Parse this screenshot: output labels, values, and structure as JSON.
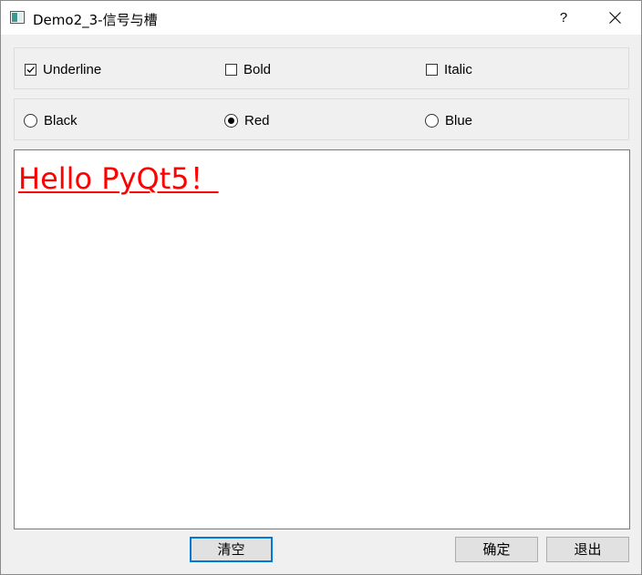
{
  "window": {
    "title": "Demo2_3-信号与槽",
    "help_label": "?",
    "icons": {
      "app": "app-window-icon",
      "close": "close-icon"
    }
  },
  "font_options": [
    {
      "label": "Underline",
      "checked": true
    },
    {
      "label": "Bold",
      "checked": false
    },
    {
      "label": "Italic",
      "checked": false
    }
  ],
  "color_options": [
    {
      "label": "Black",
      "selected": false
    },
    {
      "label": "Red",
      "selected": true
    },
    {
      "label": "Blue",
      "selected": false
    }
  ],
  "editor": {
    "text": "Hello PyQt5！",
    "color": "#ff0000",
    "underline": true
  },
  "buttons": {
    "clear": "清空",
    "ok": "确定",
    "exit": "退出"
  },
  "colors": {
    "focus_border": "#0078d7",
    "text_red": "#ff0000"
  }
}
